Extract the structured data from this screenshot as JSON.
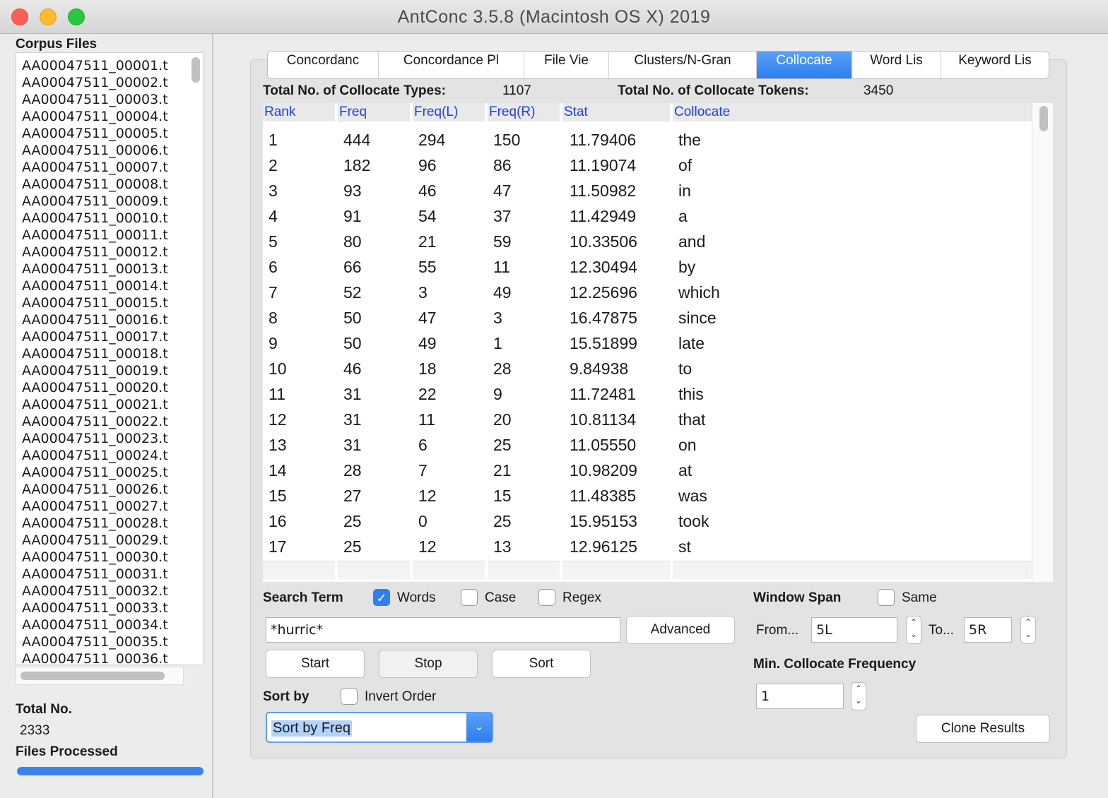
{
  "window": {
    "title": "AntConc 3.5.8 (Macintosh OS X) 2019"
  },
  "left": {
    "corpus_label": "Corpus Files",
    "files": [
      "AA00047511_00001.t",
      "AA00047511_00002.t",
      "AA00047511_00003.t",
      "AA00047511_00004.t",
      "AA00047511_00005.t",
      "AA00047511_00006.t",
      "AA00047511_00007.t",
      "AA00047511_00008.t",
      "AA00047511_00009.t",
      "AA00047511_00010.t",
      "AA00047511_00011.t",
      "AA00047511_00012.t",
      "AA00047511_00013.t",
      "AA00047511_00014.t",
      "AA00047511_00015.t",
      "AA00047511_00016.t",
      "AA00047511_00017.t",
      "AA00047511_00018.t",
      "AA00047511_00019.t",
      "AA00047511_00020.t",
      "AA00047511_00021.t",
      "AA00047511_00022.t",
      "AA00047511_00023.t",
      "AA00047511_00024.t",
      "AA00047511_00025.t",
      "AA00047511_00026.t",
      "AA00047511_00027.t",
      "AA00047511_00028.t",
      "AA00047511_00029.t",
      "AA00047511_00030.t",
      "AA00047511_00031.t",
      "AA00047511_00032.t",
      "AA00047511_00033.t",
      "AA00047511_00034.t",
      "AA00047511_00035.t",
      "AA00047511_00036.t"
    ],
    "total_label": "Total No.",
    "total_value": "2333",
    "processed_label": "Files Processed",
    "progress": 1.0
  },
  "tabs": [
    {
      "label": "Concordanc",
      "active": false
    },
    {
      "label": "Concordance Pl",
      "active": false
    },
    {
      "label": "File Vie",
      "active": false
    },
    {
      "label": "Clusters/N-Gran",
      "active": false
    },
    {
      "label": "Collocate",
      "active": true
    },
    {
      "label": "Word Lis",
      "active": false
    },
    {
      "label": "Keyword Lis",
      "active": false
    }
  ],
  "totals": {
    "types_label": "Total No. of Collocate Types:",
    "types_value": "1107",
    "tokens_label": "Total No. of Collocate Tokens:",
    "tokens_value": "3450"
  },
  "table": {
    "columns": [
      "Rank",
      "Freq",
      "Freq(L)",
      "Freq(R)",
      "Stat",
      "Collocate"
    ],
    "rows": [
      [
        "1",
        "444",
        "294",
        "150",
        "11.79406",
        "the"
      ],
      [
        "2",
        "182",
        "96",
        "86",
        "11.19074",
        "of"
      ],
      [
        "3",
        "93",
        "46",
        "47",
        "11.50982",
        "in"
      ],
      [
        "4",
        "91",
        "54",
        "37",
        "11.42949",
        "a"
      ],
      [
        "5",
        "80",
        "21",
        "59",
        "10.33506",
        "and"
      ],
      [
        "6",
        "66",
        "55",
        "11",
        "12.30494",
        "by"
      ],
      [
        "7",
        "52",
        "3",
        "49",
        "12.25696",
        "which"
      ],
      [
        "8",
        "50",
        "47",
        "3",
        "16.47875",
        "since"
      ],
      [
        "9",
        "50",
        "49",
        "1",
        "15.51899",
        "late"
      ],
      [
        "10",
        "46",
        "18",
        "28",
        "9.84938",
        "to"
      ],
      [
        "11",
        "31",
        "22",
        "9",
        "11.72481",
        "this"
      ],
      [
        "12",
        "31",
        "11",
        "20",
        "10.81134",
        "that"
      ],
      [
        "13",
        "31",
        "6",
        "25",
        "11.05550",
        "on"
      ],
      [
        "14",
        "28",
        "7",
        "21",
        "10.98209",
        "at"
      ],
      [
        "15",
        "27",
        "12",
        "15",
        "11.48385",
        "was"
      ],
      [
        "16",
        "25",
        "0",
        "25",
        "15.95153",
        "took"
      ],
      [
        "17",
        "25",
        "12",
        "13",
        "12.96125",
        "st"
      ]
    ]
  },
  "search": {
    "label": "Search Term",
    "words_label": "Words",
    "words_checked": true,
    "case_label": "Case",
    "case_checked": false,
    "regex_label": "Regex",
    "regex_checked": false,
    "value": "*hurric*",
    "advanced_label": "Advanced"
  },
  "buttons": {
    "start": "Start",
    "stop": "Stop",
    "sort": "Sort",
    "clone": "Clone Results"
  },
  "sort": {
    "label": "Sort by",
    "invert_label": "Invert Order",
    "invert_checked": false,
    "selected": "Sort by Freq"
  },
  "window_span": {
    "label": "Window Span",
    "same_label": "Same",
    "same_checked": false,
    "from_label": "From...",
    "from_value": "5L",
    "to_label": "To...",
    "to_value": "5R"
  },
  "min_freq": {
    "label": "Min. Collocate Frequency",
    "value": "1"
  }
}
